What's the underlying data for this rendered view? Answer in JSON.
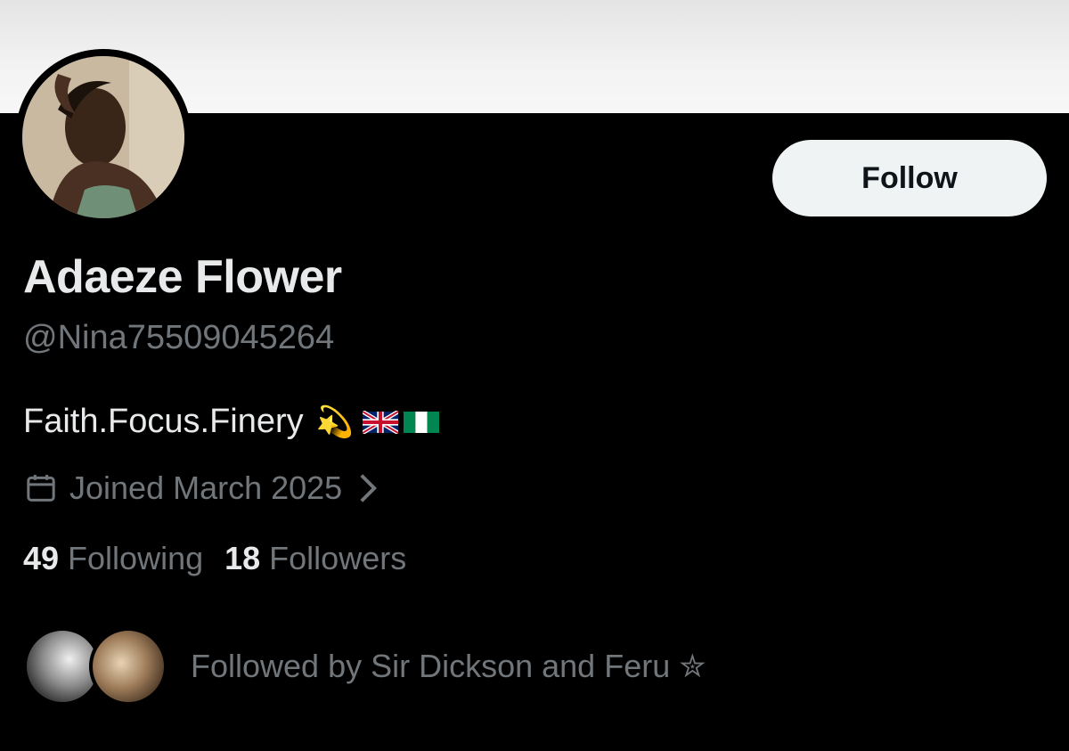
{
  "profile": {
    "name": "Adaeze Flower",
    "handle": "@Nina75509045264",
    "bio": "Faith.Focus.Finery",
    "bio_emoji": "💫",
    "flags": [
      "uk-flag",
      "nigeria-flag"
    ],
    "joined": "Joined March 2025",
    "following_count": "49",
    "following_label": "Following",
    "followers_count": "18",
    "followers_label": "Followers",
    "followed_by": "Followed by Sir Dickson and Feru ✮"
  },
  "actions": {
    "follow_label": "Follow"
  },
  "icons": {
    "calendar": "calendar-icon",
    "chevron": "chevron-right-icon"
  },
  "colors": {
    "background": "#000000",
    "primary_text": "#e7e9ea",
    "secondary_text": "#71767b",
    "follow_button_bg": "#eff3f4"
  }
}
